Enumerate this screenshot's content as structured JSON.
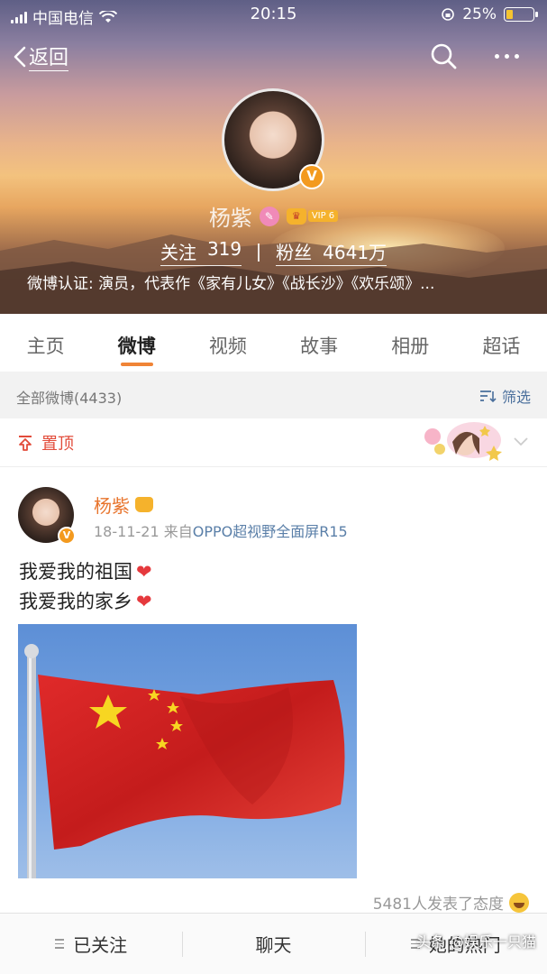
{
  "status_bar": {
    "carrier": "中国电信",
    "time": "20:15",
    "battery": "25%",
    "battery_level": 0.25
  },
  "nav": {
    "back_label": "返回"
  },
  "profile": {
    "name": "杨紫",
    "vip_level": "VIP 6",
    "verified_badge": "V",
    "following_label": "关注",
    "following_count": "319",
    "followers_label": "粉丝",
    "followers_count": "4641万",
    "certification": "微博认证: 演员，代表作《家有儿女》《战长沙》《欢乐颂》..."
  },
  "tabs": [
    {
      "label": "主页"
    },
    {
      "label": "微博"
    },
    {
      "label": "视频"
    },
    {
      "label": "故事"
    },
    {
      "label": "相册"
    },
    {
      "label": "超话"
    }
  ],
  "filter_bar": {
    "count_label": "全部微博(4433)",
    "filter_label": "筛选"
  },
  "pinned": {
    "label": "置顶"
  },
  "post": {
    "author": "杨紫",
    "date": "18-11-21",
    "source_prefix": "来自",
    "source": "OPPO超视野全面屏R15",
    "lines": [
      "我爱我的祖国",
      "我爱我的家乡"
    ],
    "reactions": "5481人发表了态度"
  },
  "bottom_bar": {
    "followed": "已关注",
    "chat": "聊天",
    "hot": "她的热门"
  },
  "watermark": "头条 @娱乐一只猫",
  "colors": {
    "accent": "#f08436",
    "author": "#e8742c",
    "link": "#5a7fa8",
    "pinned": "#e24b3a"
  }
}
